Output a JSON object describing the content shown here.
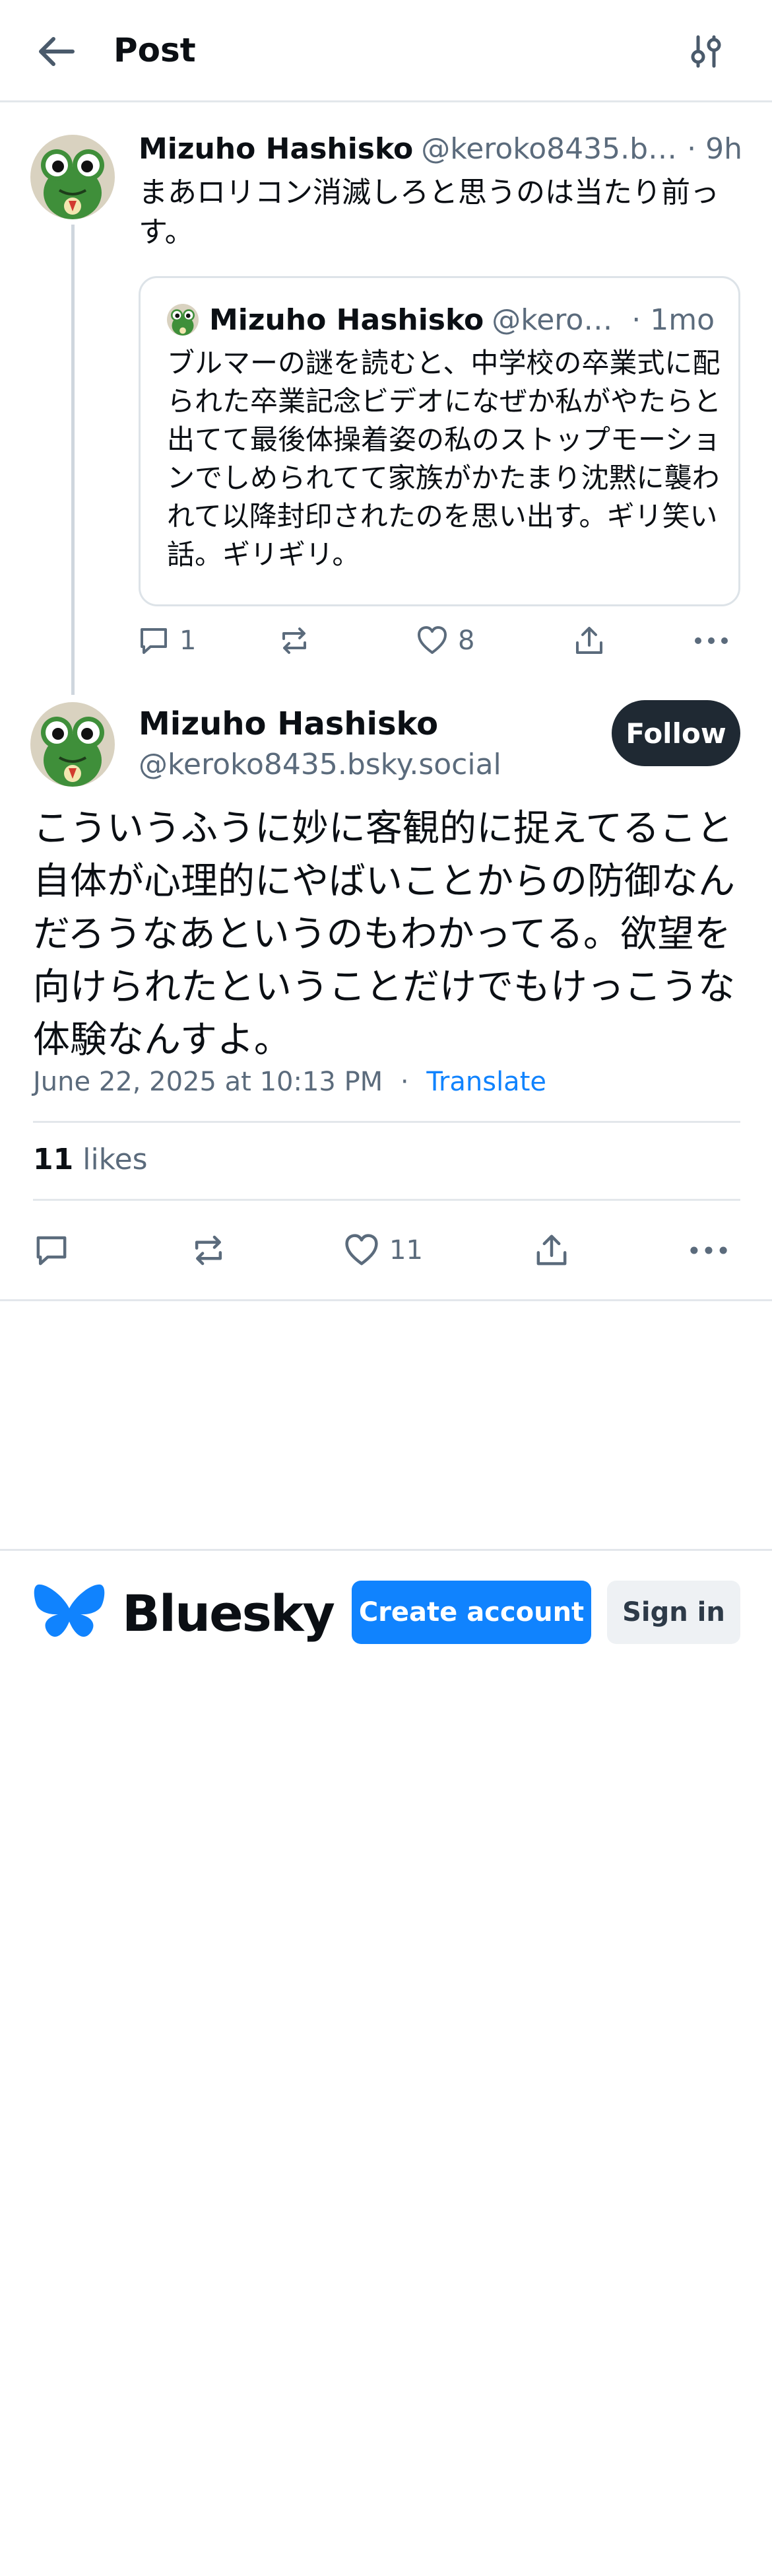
{
  "header": {
    "title": "Post",
    "back_icon": "arrow-left-icon",
    "settings_icon": "sliders-icon"
  },
  "parent_post": {
    "author_name": "Mizuho Hashisko",
    "author_handle": "@keroko8435.bsk...",
    "time": "· 9h",
    "text": "まあロリコン消滅しろと思うのは当たり前っす。",
    "quote": {
      "author_name": "Mizuho Hashisko",
      "author_handle": "@keroko8...",
      "time": "· 1mo",
      "text": "ブルマーの謎を読むと、中学校の卒業式に配られた卒業記念ビデオになぜか私がやたらと出てて最後体操着姿の私のストップモーションでしめられてて家族がかたまり沈黙に襲われて以降封印されたのを思い出す。ギリ笑い話。ギリギリ。"
    },
    "actions": {
      "replies": "1",
      "likes": "8"
    }
  },
  "main_post": {
    "author_name": "Mizuho Hashisko",
    "author_handle": "@keroko8435.bsky.social",
    "follow_label": "Follow",
    "text": "こういうふうに妙に客観的に捉えてること自体が心理的にやばいことからの防御なんだろうなあというのもわかってる。欲望を向けられたということだけでもけっこうな体験なんすよ。",
    "timestamp": "June 22, 2025 at 10:13 PM",
    "separator": "·",
    "translate_label": "Translate",
    "likes_count": "11",
    "likes_label": "likes",
    "actions": {
      "likes": "11"
    }
  },
  "footer": {
    "brand": "Bluesky",
    "create_account_label": "Create account",
    "sign_in_label": "Sign in"
  },
  "colors": {
    "accent": "#1083fe",
    "text_primary": "#0b0f14",
    "text_secondary": "#5b6b7c",
    "follow_bg": "#1f2933",
    "border": "#e3e7eb"
  }
}
